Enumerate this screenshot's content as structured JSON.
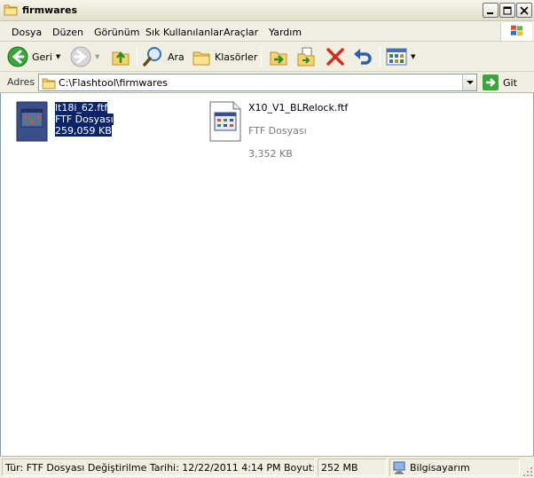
{
  "window": {
    "title": "firmwares"
  },
  "menu": [
    "Dosya",
    "Düzen",
    "Görünüm",
    "Sık Kullanılanlar",
    "Araçlar",
    "Yardım"
  ],
  "toolbar": {
    "back_label": "Geri",
    "search_label": "Ara",
    "folders_label": "Klasörler"
  },
  "address": {
    "label": "Adres",
    "path": "C:\\Flashtool\\firmwares",
    "go_label": "Git"
  },
  "files": [
    {
      "name": "lt18i_62.ftf",
      "type": "FTF Dosyası",
      "size": "259,059 KB",
      "selected": true
    },
    {
      "name": "X10_V1_BLRelock.ftf",
      "type": "FTF Dosyası",
      "size": "3,352 KB",
      "selected": false
    }
  ],
  "status": {
    "info": "Tür: FTF Dosyası Değiştirilme Tarihi: 12/22/2011 4:14 PM Boyut: 252 MB",
    "size": "252 MB",
    "computer": "Bilgisayarım"
  },
  "colors": {
    "selection": "#0a246a",
    "chrome": "#f1efe2"
  }
}
